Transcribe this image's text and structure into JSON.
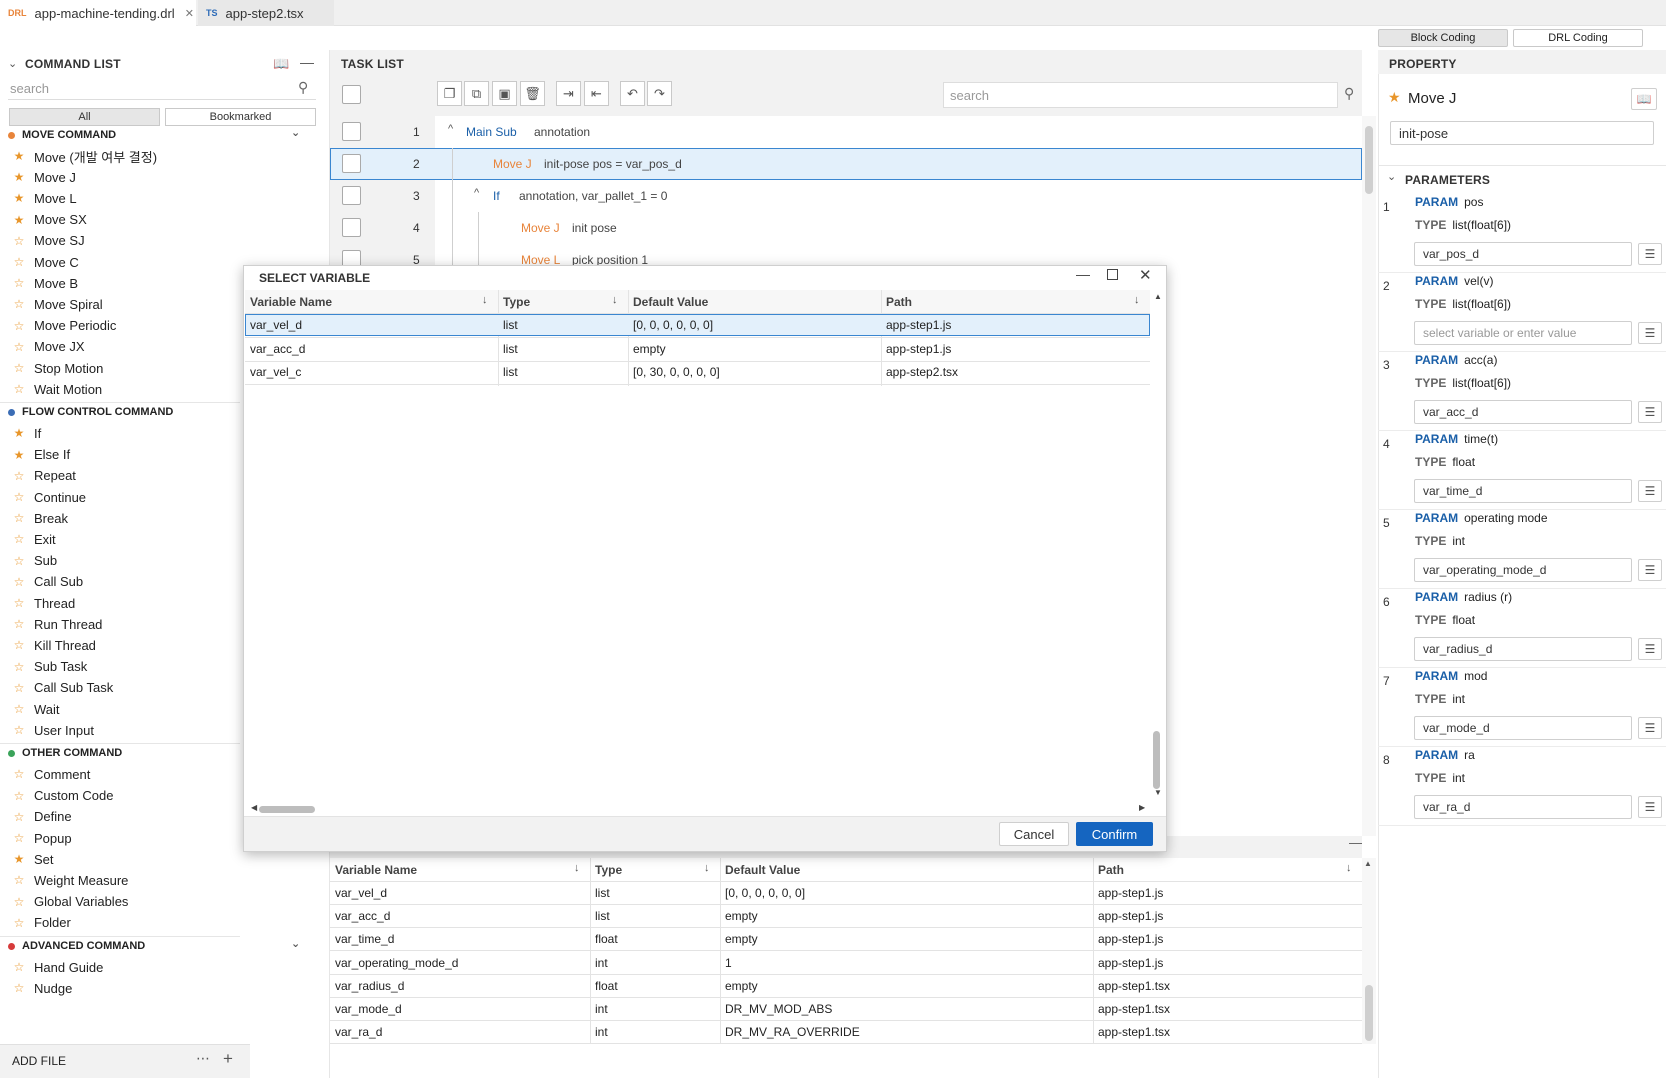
{
  "tabs": [
    {
      "icon": "DRL",
      "label": "app-machine-tending.drl",
      "close": "✕"
    },
    {
      "icon": "TS",
      "label": "app-step2.tsx"
    }
  ],
  "mode_buttons": {
    "block": "Block Coding",
    "drl": "DRL Coding"
  },
  "command_list": {
    "title": "COMMAND LIST",
    "search_placeholder": "search",
    "filter_all": "All",
    "filter_bookmarked": "Bookmarked",
    "categories": [
      {
        "title": "MOVE COMMAND",
        "color": "#e8843a",
        "items": [
          {
            "label": "Move (개발 여부 결정)",
            "starred": true
          },
          {
            "label": "Move J",
            "starred": true
          },
          {
            "label": "Move L",
            "starred": true
          },
          {
            "label": "Move SX",
            "starred": true
          },
          {
            "label": "Move SJ",
            "starred": false
          },
          {
            "label": "Move C",
            "starred": false
          },
          {
            "label": "Move B",
            "starred": false
          },
          {
            "label": "Move Spiral",
            "starred": false
          },
          {
            "label": "Move Periodic",
            "starred": false
          },
          {
            "label": "Move JX",
            "starred": false
          },
          {
            "label": "Stop Motion",
            "starred": false
          },
          {
            "label": "Wait Motion",
            "starred": false
          }
        ]
      },
      {
        "title": "FLOW CONTROL COMMAND",
        "color": "#3b6db5",
        "items": [
          {
            "label": "If",
            "starred": true
          },
          {
            "label": "Else If",
            "starred": true
          },
          {
            "label": "Repeat",
            "starred": false
          },
          {
            "label": "Continue",
            "starred": false
          },
          {
            "label": "Break",
            "starred": false
          },
          {
            "label": "Exit",
            "starred": false
          },
          {
            "label": "Sub",
            "starred": false
          },
          {
            "label": "Call Sub",
            "starred": false
          },
          {
            "label": "Thread",
            "starred": false
          },
          {
            "label": "Run Thread",
            "starred": false
          },
          {
            "label": "Kill Thread",
            "starred": false
          },
          {
            "label": "Sub Task",
            "starred": false
          },
          {
            "label": "Call Sub Task",
            "starred": false
          },
          {
            "label": "Wait",
            "starred": false
          },
          {
            "label": "User Input",
            "starred": false
          }
        ]
      },
      {
        "title": "OTHER COMMAND",
        "color": "#3aa35a",
        "items": [
          {
            "label": "Comment",
            "starred": false
          },
          {
            "label": "Custom Code",
            "starred": false
          },
          {
            "label": "Define",
            "starred": false
          },
          {
            "label": "Popup",
            "starred": false
          },
          {
            "label": "Set",
            "starred": true
          },
          {
            "label": "Weight Measure",
            "starred": false
          },
          {
            "label": "Global Variables",
            "starred": false
          },
          {
            "label": "Folder",
            "starred": false
          }
        ]
      },
      {
        "title": "ADVANCED COMMAND",
        "color": "#d63b3b",
        "items": [
          {
            "label": "Hand Guide",
            "starred": false
          },
          {
            "label": "Nudge",
            "starred": false
          }
        ]
      }
    ],
    "add_file": "ADD FILE"
  },
  "task_list": {
    "title": "TASK LIST",
    "search_placeholder": "search",
    "rows": [
      {
        "num": "1",
        "cmd": "Main Sub",
        "text": "annotation"
      },
      {
        "num": "2",
        "cmd": "Move J",
        "text": "init-pose  pos = var_pos_d"
      },
      {
        "num": "3",
        "cmd": "If",
        "text": "annotation,  var_pallet_1 = 0"
      },
      {
        "num": "4",
        "cmd": "Move J",
        "text": "init pose"
      },
      {
        "num": "5",
        "cmd": "Move L",
        "text": "pick position 1"
      }
    ]
  },
  "property": {
    "title": "PROPERTY",
    "command": "Move J",
    "name_value": "init-pose",
    "parameters_title": "PARAMETERS",
    "param_label": "PARAM",
    "type_label": "TYPE",
    "params": [
      {
        "num": "1",
        "name": "pos",
        "type": "list(float[6])",
        "value": "var_pos_d",
        "placeholder": false
      },
      {
        "num": "2",
        "name": "vel(v)",
        "type": "list(float[6])",
        "value": "select variable or enter value",
        "placeholder": true
      },
      {
        "num": "3",
        "name": "acc(a)",
        "type": "list(float[6])",
        "value": "var_acc_d",
        "placeholder": false
      },
      {
        "num": "4",
        "name": "time(t)",
        "type": "float",
        "value": "var_time_d",
        "placeholder": false
      },
      {
        "num": "5",
        "name": "operating mode",
        "type": "int",
        "value": "var_operating_mode_d",
        "placeholder": false
      },
      {
        "num": "6",
        "name": "radius (r)",
        "type": "float",
        "value": "var_radius_d",
        "placeholder": false
      },
      {
        "num": "7",
        "name": "mod",
        "type": "int",
        "value": "var_mode_d",
        "placeholder": false
      },
      {
        "num": "8",
        "name": "ra",
        "type": "int",
        "value": "var_ra_d",
        "placeholder": false
      }
    ]
  },
  "variables_table": {
    "columns": [
      "Variable Name",
      "Type",
      "Default Value",
      "Path"
    ],
    "rows": [
      [
        "var_vel_d",
        "list",
        "[0, 0, 0, 0, 0, 0]",
        "app-step1.js"
      ],
      [
        "var_acc_d",
        "list",
        "empty",
        "app-step1.js"
      ],
      [
        "var_time_d",
        "float",
        "empty",
        "app-step1.js"
      ],
      [
        "var_operating_mode_d",
        "int",
        "1",
        "app-step1.js"
      ],
      [
        "var_radius_d",
        "float",
        "empty",
        "app-step1.tsx"
      ],
      [
        "var_mode_d",
        "int",
        "DR_MV_MOD_ABS",
        "app-step1.tsx"
      ],
      [
        "var_ra_d",
        "int",
        "DR_MV_RA_OVERRIDE",
        "app-step1.tsx"
      ]
    ]
  },
  "dialog": {
    "title": "SELECT VARIABLE",
    "columns": [
      "Variable Name",
      "Type",
      "Default Value",
      "Path"
    ],
    "rows": [
      [
        "var_vel_d",
        "list",
        "[0, 0, 0, 0, 0, 0]",
        "app-step1.js"
      ],
      [
        "var_acc_d",
        "list",
        "empty",
        "app-step1.js"
      ],
      [
        "var_vel_c",
        "list",
        "[0, 30, 0, 0, 0, 0]",
        "app-step2.tsx"
      ]
    ],
    "cancel": "Cancel",
    "confirm": "Confirm"
  },
  "colors": {
    "accent": "#1565c0",
    "selection": "#e3f0fb",
    "move_cmd": "#e8843a",
    "flow_cmd": "#1a5fa8"
  }
}
